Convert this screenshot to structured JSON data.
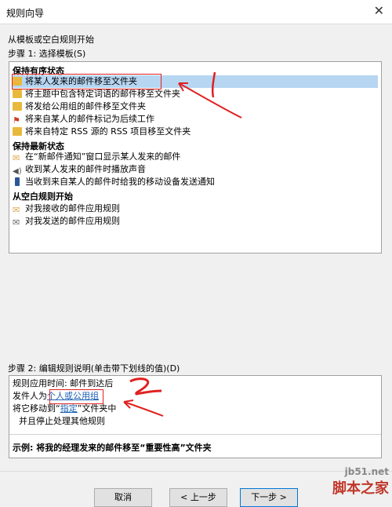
{
  "window": {
    "title": "规则向导"
  },
  "intro": "从模板或空白规则开始",
  "step1": {
    "label": "步骤 1: 选择模板(S)"
  },
  "templates": {
    "group1": {
      "title": "保持有序状态",
      "items": [
        "将某人发来的邮件移至文件夹",
        "将主题中包含特定词语的邮件移至文件夹",
        "将发给公用组的邮件移至文件夹",
        "将来自某人的邮件标记为后续工作",
        "将来自特定 RSS 源的 RSS 项目移至文件夹"
      ]
    },
    "group2": {
      "title": "保持最新状态",
      "items": [
        "在“新邮件通知”窗口显示某人发来的邮件",
        "收到某人发来的邮件时播放声音",
        "当收到来自某人的邮件时给我的移动设备发送通知"
      ]
    },
    "group3": {
      "title": "从空白规则开始",
      "items": [
        "对我接收的邮件应用规则",
        "对我发送的邮件应用规则"
      ]
    }
  },
  "step2": {
    "label": "步骤 2: 编辑规则说明(单击带下划线的值)(D)"
  },
  "description": {
    "line1": "规则应用时间: 邮件到达后",
    "line2_prefix": "发件人为",
    "line2_link": "个人或公用组",
    "line3_prefix": "将它移动到",
    "line3_link": "指定",
    "line3_suffix": "文件夹中",
    "line4": "并且停止处理其他规则"
  },
  "example": "示例: 将我的经理发来的邮件移至“重要性高”文件夹",
  "annotations": {
    "mark1": "1",
    "mark2": "2"
  },
  "buttons": {
    "cancel": "取消",
    "back": "< 上一步",
    "next": "下一步 >"
  },
  "watermark": {
    "line1": "jb51.net",
    "line2": "脚本之家"
  },
  "colors": {
    "selection": "#b6d6f2",
    "annotation": "#e02020",
    "link": "#1a5fb4"
  }
}
